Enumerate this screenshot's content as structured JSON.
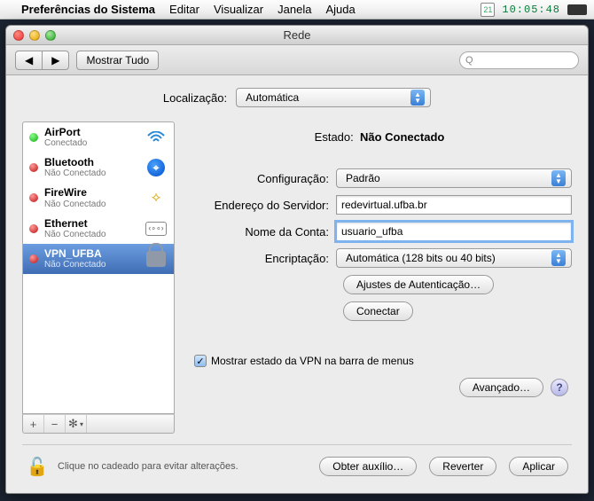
{
  "menubar": {
    "appname": "Preferências do Sistema",
    "items": [
      "Editar",
      "Visualizar",
      "Janela",
      "Ajuda"
    ],
    "date_badge": "21",
    "clock": "10:05:48"
  },
  "window": {
    "title": "Rede",
    "show_all": "Mostrar Tudo",
    "nav_back": "◀",
    "nav_fwd": "▶",
    "search_placeholder": "Q"
  },
  "location": {
    "label": "Localização:",
    "value": "Automática"
  },
  "services": [
    {
      "name": "AirPort",
      "sub": "Conectado",
      "status": "green",
      "icon": "wifi"
    },
    {
      "name": "Bluetooth",
      "sub": "Não Conectado",
      "status": "red",
      "icon": "bt"
    },
    {
      "name": "FireWire",
      "sub": "Não Conectado",
      "status": "red",
      "icon": "fw"
    },
    {
      "name": "Ethernet",
      "sub": "Não Conectado",
      "status": "red",
      "icon": "eth"
    },
    {
      "name": "VPN_UFBA",
      "sub": "Não Conectado",
      "status": "red",
      "icon": "lock",
      "selected": true
    }
  ],
  "tool_add": "+",
  "tool_remove": "−",
  "tool_gear": "✻",
  "details": {
    "state_label": "Estado:",
    "state_value": "Não Conectado",
    "config_label": "Configuração:",
    "config_value": "Padrão",
    "server_label": "Endereço do Servidor:",
    "server_value": "redevirtual.ufba.br",
    "account_label": "Nome da Conta:",
    "account_value": "usuario_ufba",
    "encryption_label": "Encriptação:",
    "encryption_value": "Automática (128 bits ou 40 bits)",
    "auth_btn": "Ajustes de Autenticação…",
    "connect_btn": "Conectar",
    "show_status_chk": "Mostrar estado da VPN na barra de menus",
    "advanced_btn": "Avançado…",
    "help": "?"
  },
  "footer": {
    "locknote": "Clique no cadeado para evitar alterações.",
    "assist": "Obter auxílio…",
    "revert": "Reverter",
    "apply": "Aplicar"
  }
}
